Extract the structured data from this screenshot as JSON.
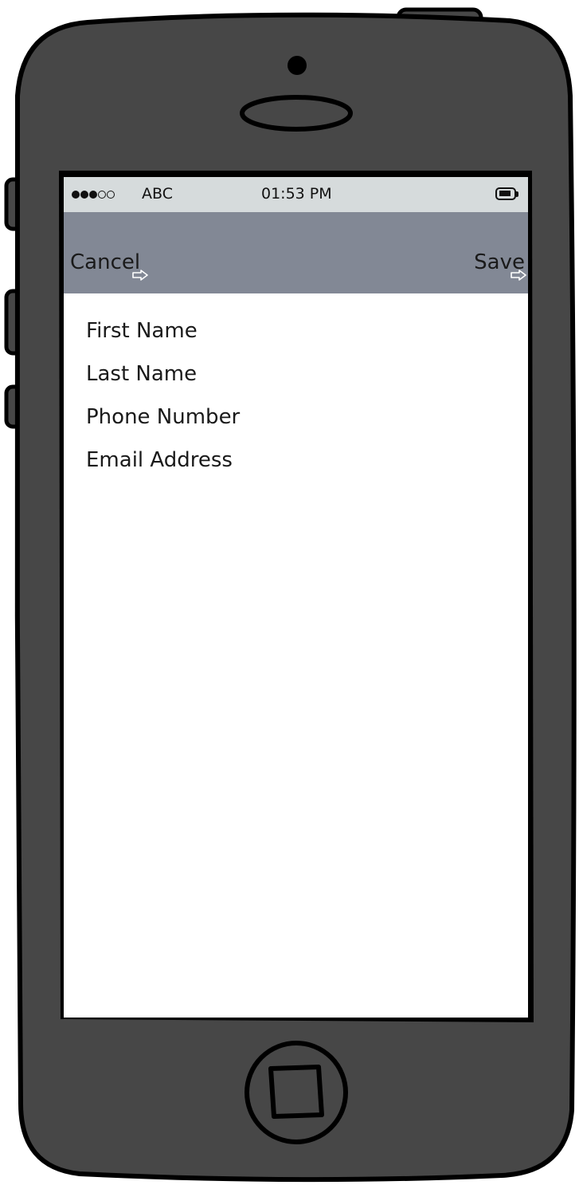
{
  "status_bar": {
    "signal": {
      "filled": 3,
      "empty": 2
    },
    "carrier": "ABC",
    "time": "01:53 PM",
    "battery_icon": "battery-icon"
  },
  "nav_bar": {
    "cancel_label": "Cancel",
    "save_label": "Save",
    "link_icon": "arrow-link-icon"
  },
  "form": {
    "fields": [
      {
        "label": "First Name"
      },
      {
        "label": "Last Name"
      },
      {
        "label": "Phone Number"
      },
      {
        "label": "Email Address"
      }
    ]
  },
  "colors": {
    "device_body": "#474747",
    "status_bar_bg": "#d6dbdc",
    "nav_bar_bg": "#828895",
    "screen_bg": "#ffffff"
  }
}
